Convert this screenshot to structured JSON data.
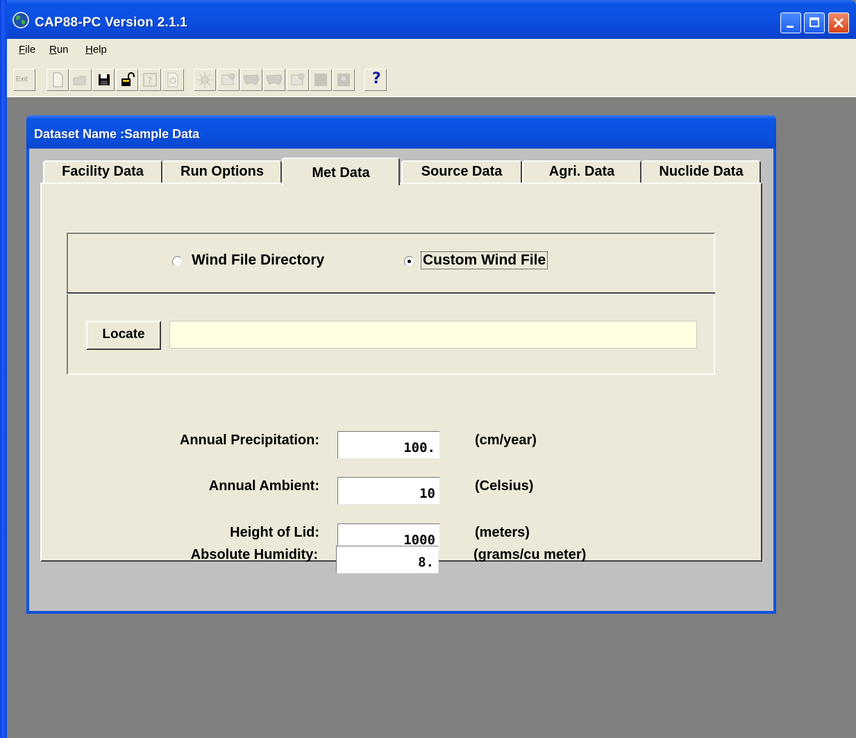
{
  "window": {
    "title": "CAP88-PC Version 2.1.1"
  },
  "menu": {
    "items": [
      {
        "label": "File",
        "key": "F",
        "rest": "ile"
      },
      {
        "label": "Run",
        "key": "R",
        "rest": "un"
      },
      {
        "label": "Help",
        "key": "H",
        "rest": "elp"
      }
    ]
  },
  "toolbar": {
    "exit_label": "Exit",
    "help_label": "?"
  },
  "dataset": {
    "title": "Dataset Name :Sample Data"
  },
  "tabs": [
    {
      "label": "Facility Data"
    },
    {
      "label": "Run Options"
    },
    {
      "label": "Met Data"
    },
    {
      "label": "Source Data"
    },
    {
      "label": "Agri. Data"
    },
    {
      "label": "Nuclide Data"
    }
  ],
  "met": {
    "wind_options": [
      {
        "label": "Wind File Directory",
        "checked": false
      },
      {
        "label": "Custom Wind File",
        "checked": true
      }
    ],
    "locate_label": "Locate",
    "wind_file_value": "",
    "fields": [
      {
        "label": "Annual Precipitation:",
        "value": "100.",
        "unit": "(cm/year)"
      },
      {
        "label": "Annual Ambient:",
        "value": "10",
        "unit": "(Celsius)"
      },
      {
        "label": "Height of Lid:",
        "value": "1000",
        "unit": "(meters)"
      },
      {
        "label": "Absolute Humidity:",
        "value": "8.",
        "unit": "(grams/cu meter)"
      }
    ]
  }
}
